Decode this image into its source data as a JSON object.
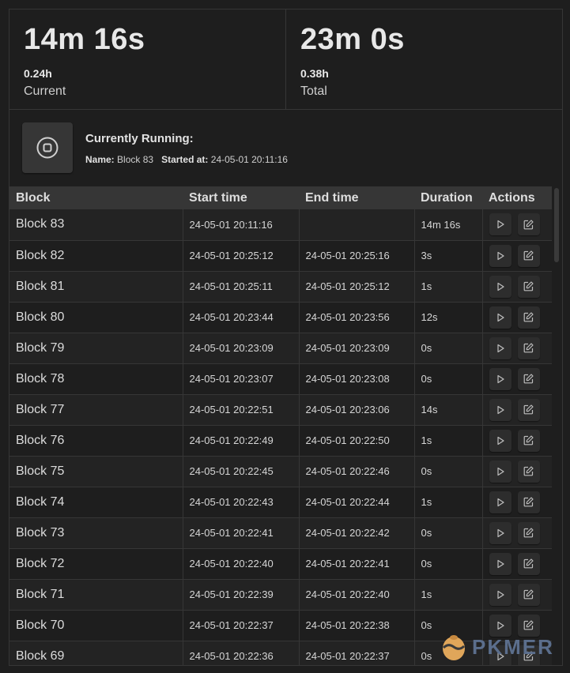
{
  "stats": {
    "current": {
      "time": "14m 16s",
      "hours": "0.24h",
      "label": "Current"
    },
    "total": {
      "time": "23m 0s",
      "hours": "0.38h",
      "label": "Total"
    }
  },
  "running": {
    "title": "Currently Running:",
    "name_label": "Name:",
    "name_value": "Block 83",
    "started_label": "Started at:",
    "started_value": "24-05-01 20:11:16"
  },
  "table": {
    "headers": {
      "block": "Block",
      "start": "Start time",
      "end": "End time",
      "duration": "Duration",
      "actions": "Actions"
    },
    "rows": [
      {
        "block": "Block 83",
        "start": "24-05-01 20:11:16",
        "end": "",
        "duration": "14m 16s"
      },
      {
        "block": "Block 82",
        "start": "24-05-01 20:25:12",
        "end": "24-05-01 20:25:16",
        "duration": "3s"
      },
      {
        "block": "Block 81",
        "start": "24-05-01 20:25:11",
        "end": "24-05-01 20:25:12",
        "duration": "1s"
      },
      {
        "block": "Block 80",
        "start": "24-05-01 20:23:44",
        "end": "24-05-01 20:23:56",
        "duration": "12s"
      },
      {
        "block": "Block 79",
        "start": "24-05-01 20:23:09",
        "end": "24-05-01 20:23:09",
        "duration": "0s"
      },
      {
        "block": "Block 78",
        "start": "24-05-01 20:23:07",
        "end": "24-05-01 20:23:08",
        "duration": "0s"
      },
      {
        "block": "Block 77",
        "start": "24-05-01 20:22:51",
        "end": "24-05-01 20:23:06",
        "duration": "14s"
      },
      {
        "block": "Block 76",
        "start": "24-05-01 20:22:49",
        "end": "24-05-01 20:22:50",
        "duration": "1s"
      },
      {
        "block": "Block 75",
        "start": "24-05-01 20:22:45",
        "end": "24-05-01 20:22:46",
        "duration": "0s"
      },
      {
        "block": "Block 74",
        "start": "24-05-01 20:22:43",
        "end": "24-05-01 20:22:44",
        "duration": "1s"
      },
      {
        "block": "Block 73",
        "start": "24-05-01 20:22:41",
        "end": "24-05-01 20:22:42",
        "duration": "0s"
      },
      {
        "block": "Block 72",
        "start": "24-05-01 20:22:40",
        "end": "24-05-01 20:22:41",
        "duration": "0s"
      },
      {
        "block": "Block 71",
        "start": "24-05-01 20:22:39",
        "end": "24-05-01 20:22:40",
        "duration": "1s"
      },
      {
        "block": "Block 70",
        "start": "24-05-01 20:22:37",
        "end": "24-05-01 20:22:38",
        "duration": "0s"
      },
      {
        "block": "Block 69",
        "start": "24-05-01 20:22:36",
        "end": "24-05-01 20:22:37",
        "duration": "0s"
      }
    ]
  },
  "icons": {
    "stop": "stop-icon",
    "play": "play-icon",
    "edit": "edit-icon",
    "watermark_logo": "pkmer-logo"
  },
  "watermark": {
    "text": "PKMER"
  },
  "colors": {
    "background": "#1e1e1e",
    "header_bg": "#363636",
    "row_alt": "#232323",
    "border": "#363636",
    "watermark": "#5b6e8c"
  }
}
